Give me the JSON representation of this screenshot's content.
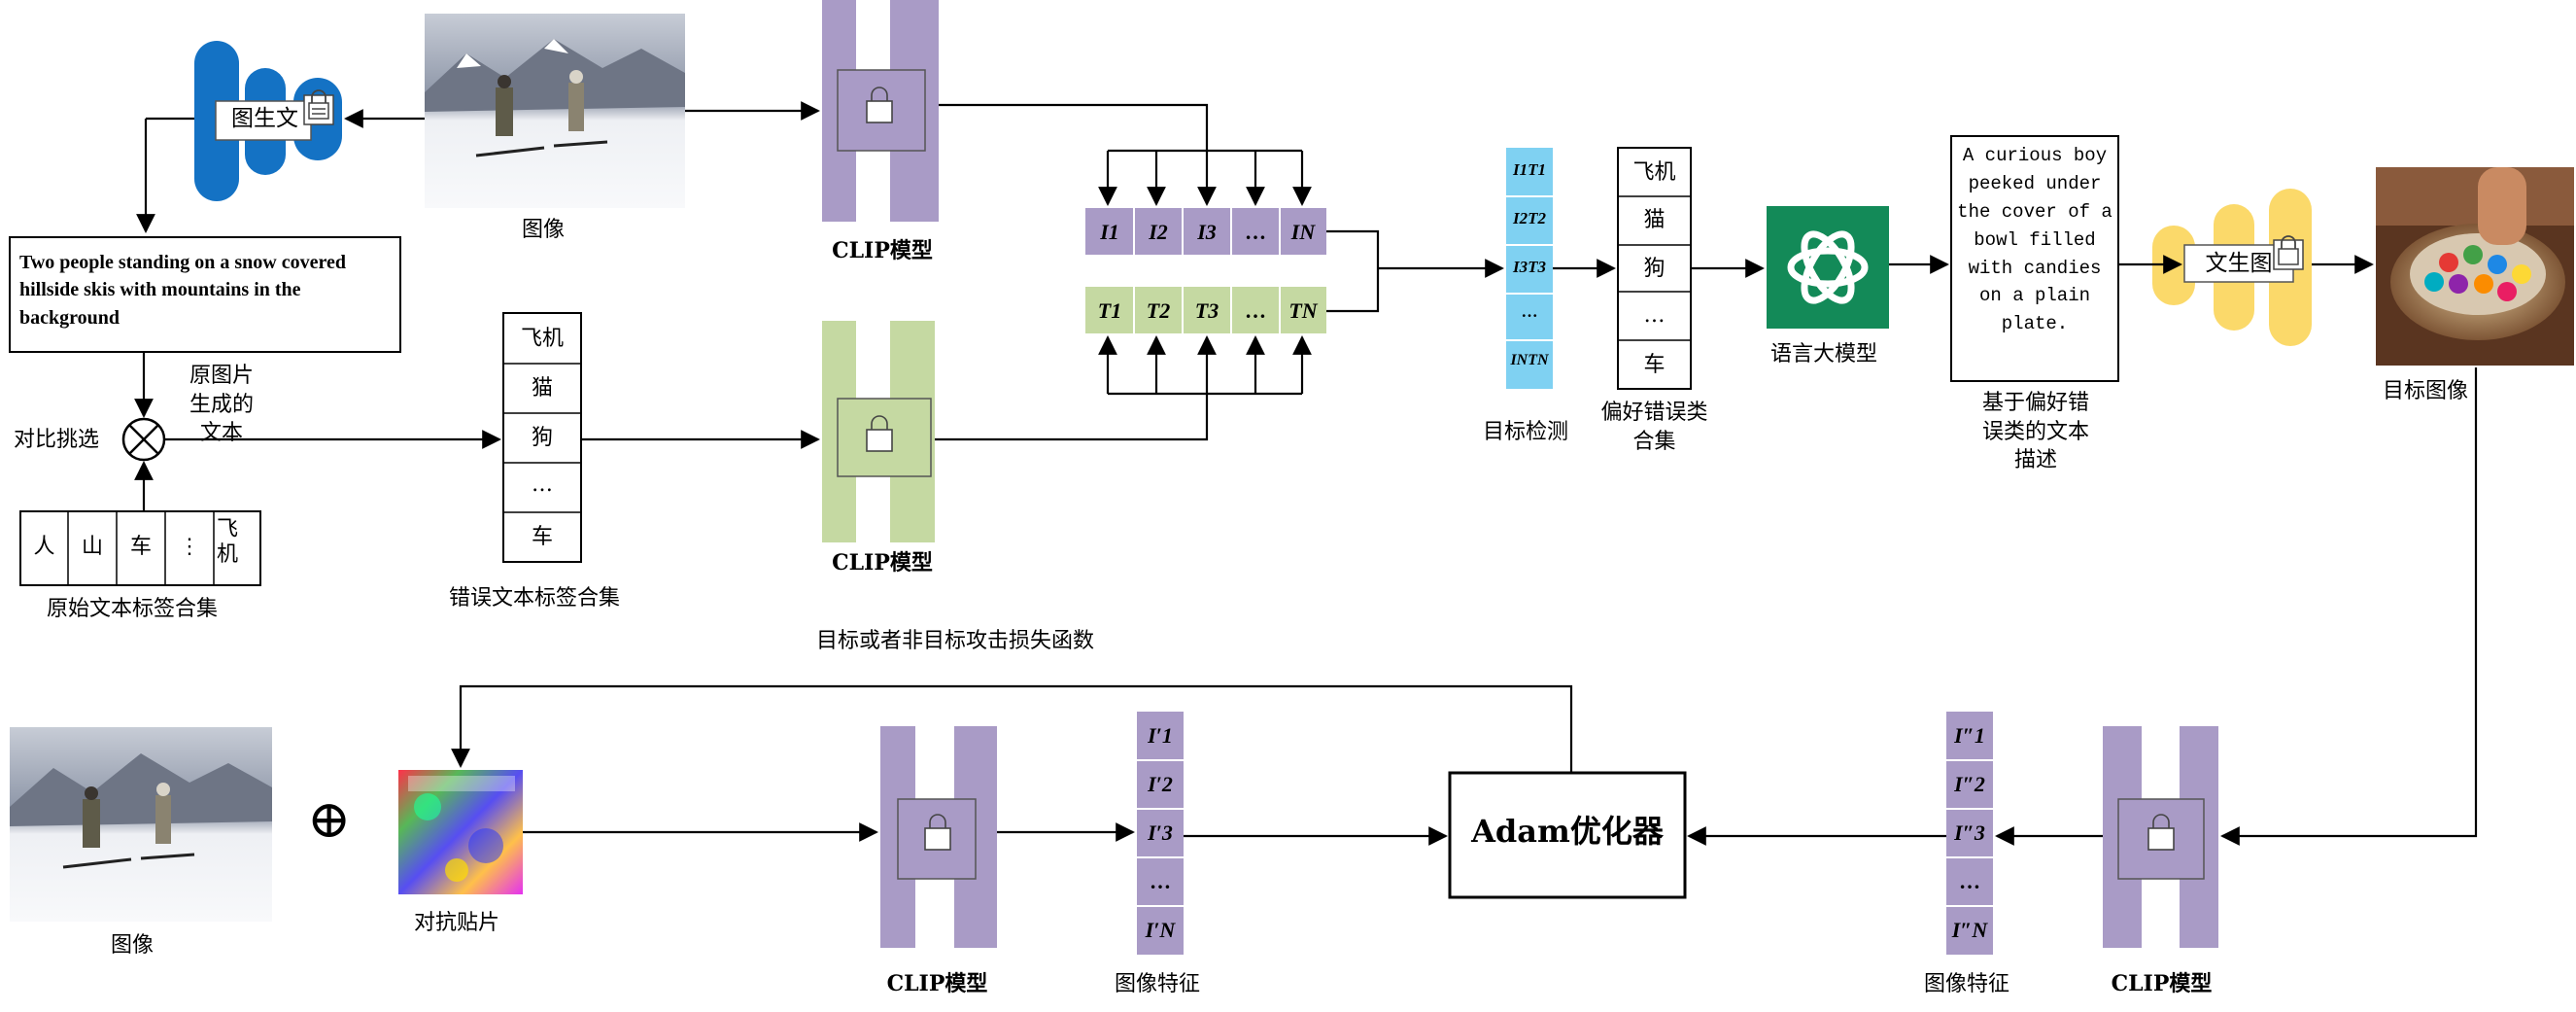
{
  "top": {
    "image_label": "图像",
    "img2text_label": "图生文",
    "caption": "Two people standing on a snow covered hillside skis with mountains in the background",
    "orig_caption_label": "原图片生成的文本",
    "compare_label": "对比挑选",
    "orig_tags": [
      "人",
      "山",
      "车",
      "⋮",
      "飞机"
    ],
    "orig_tags_label": "原始文本标签合集",
    "wrong_tags": [
      "飞机",
      "猫",
      "狗",
      "…",
      "车"
    ],
    "wrong_tags_label": "错误文本标签合集",
    "clip_label": "CLIP模型",
    "image_feats": [
      "I1",
      "I2",
      "I3",
      "…",
      "IN"
    ],
    "text_feats": [
      "T1",
      "T2",
      "T3",
      "…",
      "TN"
    ],
    "loss_label": "目标或者非目标攻击损失函数",
    "det_items": [
      "I1T1",
      "I2T2",
      "I3T3",
      "…",
      "INTN"
    ],
    "det_label": "目标检测",
    "pref_items": [
      "飞机",
      "猫",
      "狗",
      "…",
      "车"
    ],
    "pref_label": "偏好错误类合集",
    "llm_label": "语言大模型",
    "desc_text": "A curious boy peeked under the cover of a bowl filled with candies on a plain plate.",
    "desc_label": "基于偏好错误类的文本描述",
    "text2img_label": "文生图",
    "target_label": "目标图像"
  },
  "bottom": {
    "image_label": "图像",
    "plus_symbol": "⊕",
    "patch_label": "对抗贴片",
    "clip_label": "CLIP模型",
    "feat_label": "图像特征",
    "feats_a": [
      "I′1",
      "I′2",
      "I′3",
      "…",
      "I′N"
    ],
    "feats_b": [
      "I″1",
      "I″2",
      "I″3",
      "…",
      "I″N"
    ],
    "optimizer_label": "Adam优化器"
  },
  "colors": {
    "purple": "#a99bc6",
    "green": "#c5d9a2",
    "cyan": "#7fd1f2",
    "blue": "#1472c4",
    "yellow": "#fbd96a",
    "openai_green": "#138a58"
  }
}
